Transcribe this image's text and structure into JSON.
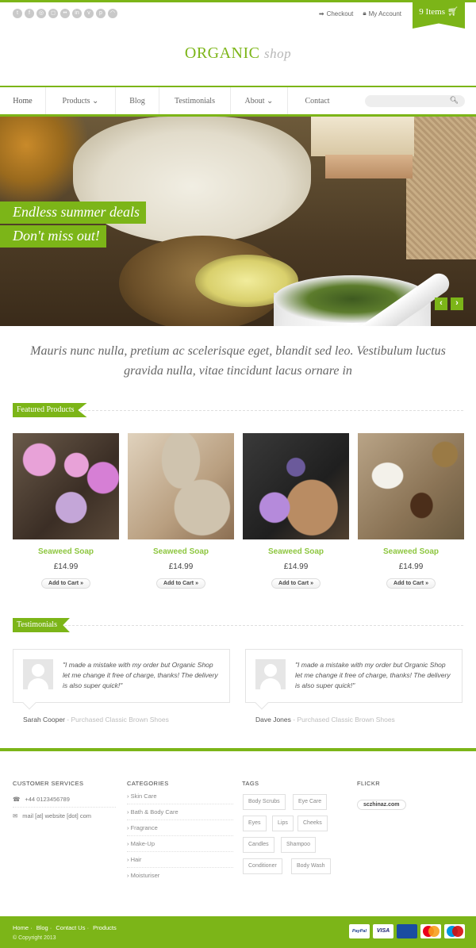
{
  "topbar": {
    "social_icons": [
      "twitter-icon",
      "facebook-icon",
      "dribbble-icon",
      "instagram-icon",
      "flickr-icon",
      "linkedin-icon",
      "vimeo-icon",
      "pinterest-icon",
      "rss-icon"
    ],
    "checkout": "Checkout",
    "my_account": "My Account",
    "cart": "9 Items"
  },
  "logo": {
    "brand": "ORGANIC",
    "suffix": "shop"
  },
  "nav": {
    "items": [
      "Home",
      "Products",
      "Blog",
      "Testimonials",
      "About",
      "Contact"
    ],
    "search_placeholder": ""
  },
  "hero": {
    "caption_line1": "Endless summer deals",
    "caption_line2": "Don't miss out!",
    "prev": "‹",
    "next": "›"
  },
  "tagline": "Mauris nunc nulla, pretium ac scelerisque eget, blandit sed leo. Vestibulum luctus gravida nulla, vitae tincidunt lacus ornare in",
  "featured": {
    "heading": "Featured Products",
    "products": [
      {
        "name": "Seaweed Soap",
        "price": "£14.99",
        "button": "Add to Cart »"
      },
      {
        "name": "Seaweed Soap",
        "price": "£14.99",
        "button": "Add to Cart »"
      },
      {
        "name": "Seaweed Soap",
        "price": "£14.99",
        "button": "Add to Cart »"
      },
      {
        "name": "Seaweed Soap",
        "price": "£14.99",
        "button": "Add to Cart »"
      }
    ]
  },
  "testimonials": {
    "heading": "Testimonials",
    "items": [
      {
        "quote": "\"I made a mistake with my order but Organic Shop let me change it free of charge, thanks! The delivery is also super quick!\"",
        "author": "Sarah Cooper",
        "meta": "Purchased Classic Brown Shoes"
      },
      {
        "quote": "\"I made a mistake with my order but Organic Shop let me change it free of charge, thanks! The delivery is also super quick!\"",
        "author": "Dave Jones",
        "meta": "Purchased Classic Brown Shoes"
      }
    ]
  },
  "footer": {
    "customer_services": {
      "title": "CUSTOMER SERVICES",
      "phone": "+44 0123456789",
      "email": "mail [at] website [dot] com"
    },
    "categories": {
      "title": "CATEGORIES",
      "items": [
        "Skin Care",
        "Bath & Body Care",
        "Fragrance",
        "Make-Up",
        "Hair",
        "Moisturiser"
      ]
    },
    "tags": {
      "title": "TAGS",
      "items": [
        "Body Scrubs",
        "Eye Care",
        "Eyes",
        "Lips",
        "Cheeks",
        "Candles",
        "Shampoo",
        "Conditioner",
        "Body Wash"
      ]
    },
    "flickr": {
      "title": "FLICKR",
      "tag": "sczhinaz.com"
    }
  },
  "bottombar": {
    "links": [
      "Home",
      "Blog",
      "Contact Us",
      "Products"
    ],
    "copyright": "© Copyright 2013",
    "payments": [
      "PayPal",
      "VISA",
      "VISA Electron",
      "MasterCard",
      "Maestro"
    ]
  }
}
